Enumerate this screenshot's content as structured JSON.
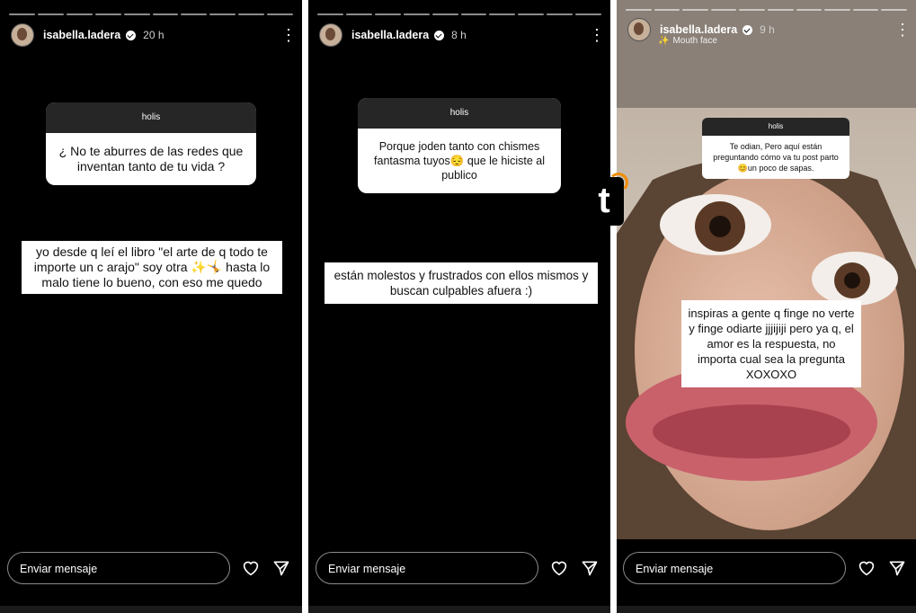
{
  "stories": [
    {
      "username": "isabella.ladera",
      "time": "20 h",
      "question_header": "holis",
      "question": "¿ No te aburres de las redes  que inventan tanto de tu vida ?",
      "answer": "yo desde q leí el libro \"el arte de q todo te importe un c arajo\" soy otra ✨🤸 hasta lo malo tiene lo bueno, con eso me quedo",
      "message_placeholder": "Enviar mensaje"
    },
    {
      "username": "isabella.ladera",
      "time": "8 h",
      "question_header": "holis",
      "question": "Porque joden tanto con chismes fantasma tuyos😔 que le hiciste al publico",
      "answer": "están molestos y frustrados con ellos mismos y buscan culpables afuera :)",
      "message_placeholder": "Enviar mensaje"
    },
    {
      "username": "isabella.ladera",
      "time": "9 h",
      "effect": "Mouth face",
      "question_header": "holis",
      "question": "Te odian, Pero aquí están preguntando cómo va tu post parto😊un poco de sapas.",
      "answer": "inspiras a gente q finge no verte y finge odiarte jjjijiji pero ya q, el amor es la respuesta, no importa cual sea la pregunta XOXOXO",
      "message_placeholder": "Enviar mensaje"
    }
  ],
  "watermark": "t",
  "icons": {
    "more": "more-vertical-icon",
    "like": "heart-icon",
    "share": "send-icon",
    "verified": "verified-badge-icon"
  },
  "colors": {
    "background": "#000000",
    "question_header": "#262626",
    "logo_accent": "#f28c00"
  }
}
